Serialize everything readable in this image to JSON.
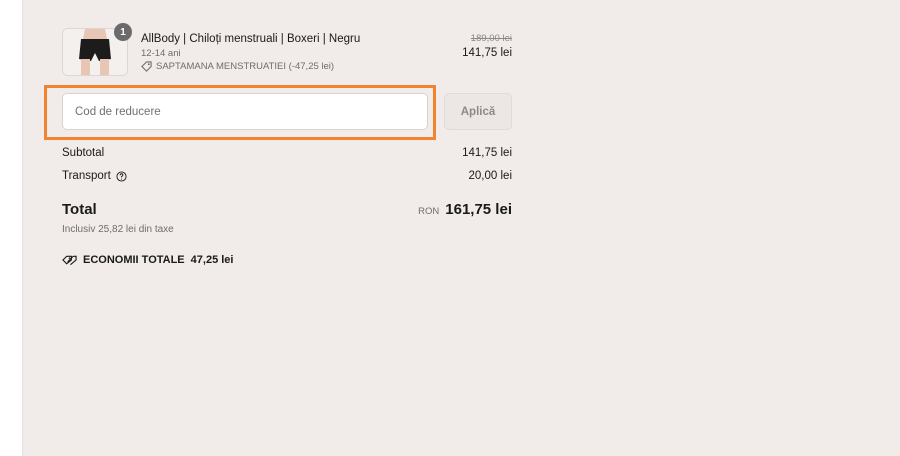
{
  "product": {
    "title": "AllBody | Chiloți menstruali | Boxeri | Negru",
    "variant": "12-14 ani",
    "discount_label": "SAPTAMANA MENSTRUATIEI (-47,25 lei)",
    "old_price": "189,00 lei",
    "price": "141,75 lei",
    "quantity": "1",
    "thumbnail_icon": "product-thumbnail"
  },
  "discount": {
    "placeholder": "Cod de reducere",
    "apply_label": "Aplică"
  },
  "summary": {
    "subtotal_label": "Subtotal",
    "subtotal_value": "141,75 lei",
    "shipping_label": "Transport",
    "shipping_value": "20,00 lei",
    "shipping_icon": "help-circle-icon"
  },
  "total": {
    "label": "Total",
    "currency": "RON",
    "amount": "161,75 lei",
    "tax_note": "Inclusiv 25,82 lei din taxe"
  },
  "savings": {
    "label": "ECONOMII TOTALE",
    "amount": "47,25 lei",
    "icon": "tags-icon"
  },
  "colors": {
    "panel_bg": "#f1ebe9",
    "highlight": "#f28430",
    "badge": "#6b6b6b"
  }
}
